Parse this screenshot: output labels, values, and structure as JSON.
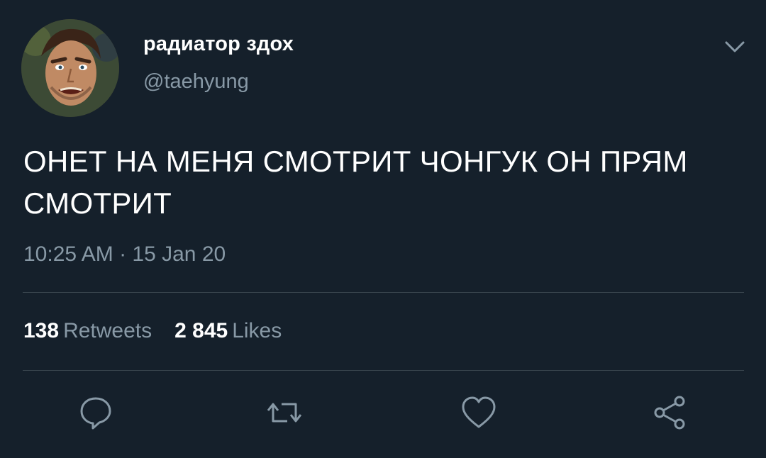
{
  "author": {
    "display_name": "радиатор здох",
    "handle": "@taehyung"
  },
  "tweet": {
    "text": "ОНЕТ НА МЕНЯ СМОТРИТ ЧОНГУК ОН ПРЯМ СМОТРИТ",
    "timestamp": "10:25 AM · 15 Jan 20"
  },
  "stats": {
    "retweets_count": "138",
    "retweets_label": "Retweets",
    "likes_count": "2 845",
    "likes_label": "Likes"
  },
  "icons": {
    "more": "chevron-down-icon",
    "reply": "reply-icon",
    "retweet": "retweet-icon",
    "like": "heart-icon",
    "share": "share-icon"
  },
  "colors": {
    "background": "#15202b",
    "secondary_text": "#8899a6",
    "divider": "#38444d"
  }
}
